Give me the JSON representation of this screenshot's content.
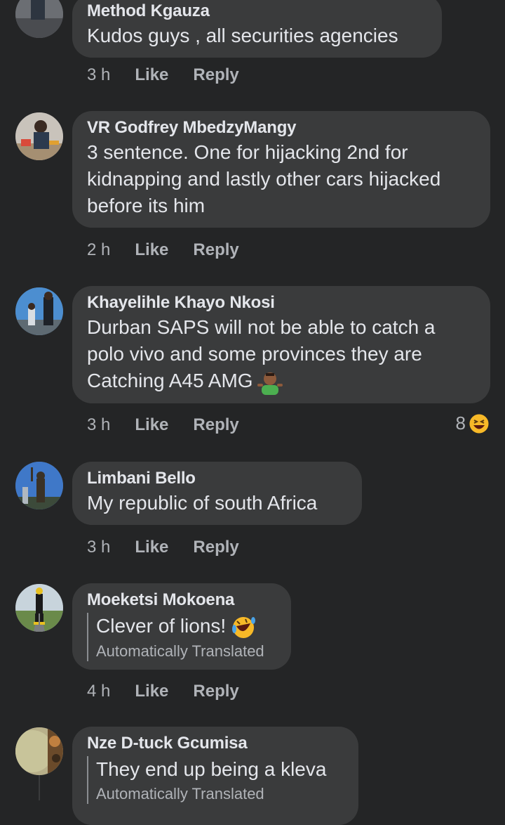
{
  "comments": [
    {
      "author": "Method Kgauza",
      "text": "Kudos guys , all securities agencies",
      "time": "3 h",
      "like": "Like",
      "reply": "Reply"
    },
    {
      "author": "VR Godfrey MbedzyMangy",
      "text": "3 sentence. One for hijacking 2nd for kidnapping and lastly other cars hijacked before its him",
      "time": "2 h",
      "like": "Like",
      "reply": "Reply"
    },
    {
      "author": "Khayelihle Khayo Nkosi",
      "text": "Durban SAPS will not be able to catch a polo vivo and some provinces they are Catching A45 AMG",
      "emoji": "person-shrugging-emoji",
      "time": "3 h",
      "like": "Like",
      "reply": "Reply",
      "reaction_count": "8",
      "reaction_icon": "laughing-face-icon"
    },
    {
      "author": "Limbani Bello",
      "text": "My republic of south Africa",
      "time": "3 h",
      "like": "Like",
      "reply": "Reply"
    },
    {
      "author": "Moeketsi Mokoena",
      "text": "Clever of lions!",
      "emoji": "rolling-on-floor-laughing-emoji",
      "translated_label": "Automatically Translated",
      "time": "4 h",
      "like": "Like",
      "reply": "Reply"
    },
    {
      "author": "Nze D-tuck Gcumisa",
      "text": "They end up being a kleva",
      "translated_label": "Automatically Translated"
    }
  ],
  "colors": {
    "background": "#242526",
    "bubble": "#3a3b3c",
    "primary_text": "#e4e6eb",
    "secondary_text": "#b0b3b8",
    "reaction_yellow": "#f7b928"
  }
}
